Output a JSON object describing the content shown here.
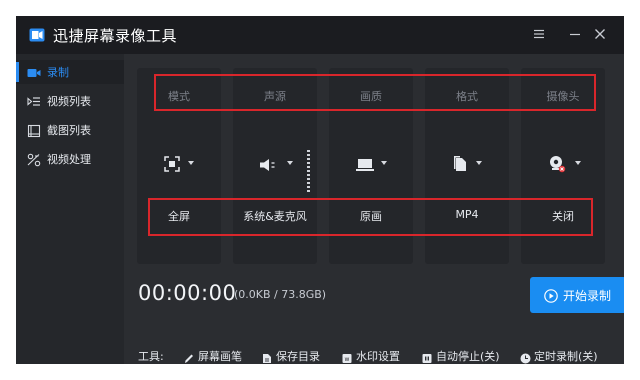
{
  "app": {
    "title": "迅捷屏幕录像工具"
  },
  "colors": {
    "accent": "#2b8cf2",
    "record_button": "#1a8df2",
    "highlight": "#d9262b"
  },
  "sidebar": {
    "items": [
      {
        "label": "录制",
        "icon": "video-camera-icon",
        "active": true
      },
      {
        "label": "视频列表",
        "icon": "video-list-icon",
        "active": false
      },
      {
        "label": "截图列表",
        "icon": "screenshot-list-icon",
        "active": false
      },
      {
        "label": "视频处理",
        "icon": "video-edit-icon",
        "active": false
      }
    ]
  },
  "settings": {
    "columns": [
      {
        "header": "模式",
        "value": "全屏",
        "icon": "fullscreen-icon"
      },
      {
        "header": "声源",
        "value": "系统&麦克风",
        "icon": "speaker-icon"
      },
      {
        "header": "画质",
        "value": "原画",
        "icon": "monitor-icon"
      },
      {
        "header": "格式",
        "value": "MP4",
        "icon": "file-format-icon"
      },
      {
        "header": "摄像头",
        "value": "关闭",
        "icon": "webcam-off-icon"
      }
    ]
  },
  "recording": {
    "time": "00:00:00",
    "size": "(0.0KB / 73.8GB)",
    "start_label": "开始录制"
  },
  "tools": {
    "label": "工具:",
    "items": [
      {
        "label": "屏幕画笔",
        "icon": "pen-icon"
      },
      {
        "label": "保存目录",
        "icon": "folder-file-icon"
      },
      {
        "label": "水印设置",
        "icon": "watermark-icon"
      },
      {
        "label": "自动停止(关)",
        "icon": "auto-stop-icon"
      },
      {
        "label": "定时录制(关)",
        "icon": "clock-icon"
      }
    ]
  }
}
